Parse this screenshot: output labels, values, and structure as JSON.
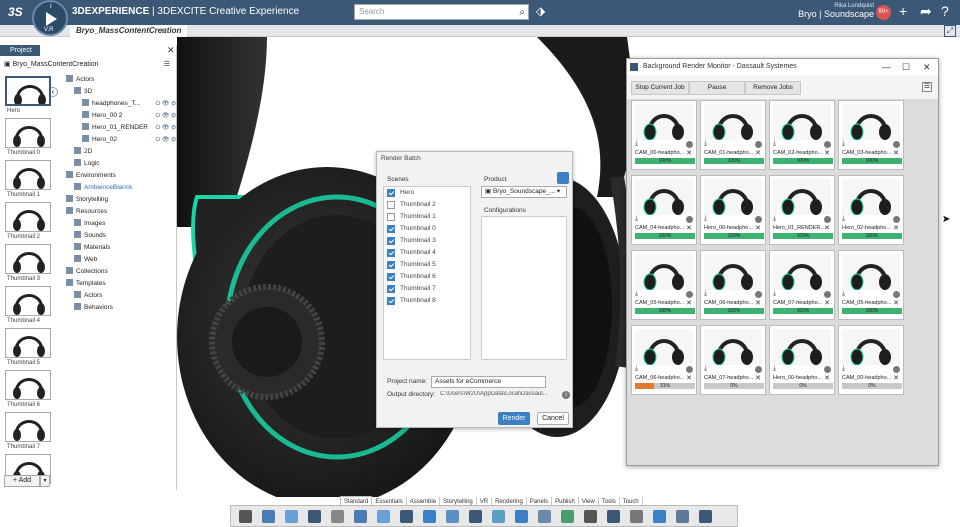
{
  "topbar": {
    "brand_prefix": "3DEXPERIENCE",
    "brand_app": "3DEXCITE Creative Experience",
    "search_placeholder": "Search",
    "user_name": "Rika Lundquist",
    "context": "Bryo | Soundscape",
    "notif_count": "99+",
    "compass_labels": [
      "V.R",
      "I"
    ]
  },
  "document": {
    "tab_label": "Bryo_MassContentCreation"
  },
  "project_panel": {
    "tab_label": "Project",
    "project_name": "Bryo_MassContentCreation",
    "thumbnails": [
      "Hero",
      "Thumbnail 0",
      "Thumbnail 1",
      "Thumbnail 2",
      "Thumbnail 3",
      "Thumbnail 4",
      "Thumbnail 5",
      "Thumbnail 6",
      "Thumbnail 7",
      ""
    ],
    "tree": [
      {
        "label": "Actors",
        "indent": 1
      },
      {
        "label": "3D",
        "indent": 2
      },
      {
        "label": "headphones_T...",
        "indent": 3
      },
      {
        "label": "Hero_00 2",
        "indent": 3
      },
      {
        "label": "Hero_01_RENDER",
        "indent": 3
      },
      {
        "label": "Hero_02",
        "indent": 3
      },
      {
        "label": "2D",
        "indent": 2
      },
      {
        "label": "Logic",
        "indent": 2
      },
      {
        "label": "Environments",
        "indent": 1
      },
      {
        "label": "AmbienceBlanck",
        "indent": 2
      },
      {
        "label": "Storytelling",
        "indent": 1
      },
      {
        "label": "Resources",
        "indent": 1
      },
      {
        "label": "Images",
        "indent": 2
      },
      {
        "label": "Sounds",
        "indent": 2
      },
      {
        "label": "Materials",
        "indent": 2
      },
      {
        "label": "Web",
        "indent": 2
      },
      {
        "label": "Collections",
        "indent": 1
      },
      {
        "label": "Templates",
        "indent": 1
      },
      {
        "label": "Actors",
        "indent": 2
      },
      {
        "label": "Behaviors",
        "indent": 2
      }
    ],
    "add_label": "Add"
  },
  "render_batch": {
    "title": "Render Batch",
    "scenes_label": "Scenes",
    "product_label": "Product",
    "configurations_label": "Configurations",
    "scenes": [
      {
        "label": "Hero",
        "checked": true
      },
      {
        "label": "Thumbnail 2",
        "checked": false
      },
      {
        "label": "Thumbnail 1",
        "checked": false
      },
      {
        "label": "Thumbnail 0",
        "checked": true
      },
      {
        "label": "Thumbnail 3",
        "checked": true
      },
      {
        "label": "Thumbnail 4",
        "checked": true
      },
      {
        "label": "Thumbnail 5",
        "checked": true
      },
      {
        "label": "Thumbnail 6",
        "checked": true
      },
      {
        "label": "Thumbnail 7",
        "checked": true
      },
      {
        "label": "Thumbnail 8",
        "checked": true
      }
    ],
    "product_value": "Bryo_Soundscape_...",
    "project_name_label": "Project name:",
    "project_name_value": "Assets for eCommerce",
    "output_dir_label": "Output directory:",
    "output_dir_value": "C:\\Users\\W2U\\AppData\\Local\\Dassaul...",
    "render_label": "Render",
    "cancel_label": "Cancel"
  },
  "monitor": {
    "title": "Background Render Monitor - Dassault Systemes",
    "stop_label": "Stop Current Job",
    "pause_label": "Pause",
    "remove_label": "Remove Jobs",
    "jobs": [
      {
        "name": "CAM_00-headpho...",
        "progress": 100,
        "label": "100%"
      },
      {
        "name": "CAM_01-headpho...",
        "progress": 100,
        "label": "100%"
      },
      {
        "name": "CAM_02-headpho...",
        "progress": 100,
        "label": "100%"
      },
      {
        "name": "CAM_03-headpho...",
        "progress": 100,
        "label": "100%"
      },
      {
        "name": "CAM_04-headpho...",
        "progress": 100,
        "label": "100%"
      },
      {
        "name": "Hero_00-headpho...",
        "progress": 100,
        "label": "100%"
      },
      {
        "name": "Hero_01_RENDER...",
        "progress": 100,
        "label": "100%"
      },
      {
        "name": "Hero_02-headpho...",
        "progress": 100,
        "label": "100%"
      },
      {
        "name": "CAM_05-headpho...",
        "progress": 100,
        "label": "100%"
      },
      {
        "name": "CAM_06-headpho...",
        "progress": 100,
        "label": "100%"
      },
      {
        "name": "CAM_07-headpho...",
        "progress": 100,
        "label": "100%"
      },
      {
        "name": "CAM_05-headpho...",
        "progress": 100,
        "label": "100%"
      },
      {
        "name": "CAM_06-headpho...",
        "progress": 31,
        "label": "31%"
      },
      {
        "name": "CAM_07-headpho...",
        "progress": 0,
        "label": "0%"
      },
      {
        "name": "Hero_00-headpho...",
        "progress": 0,
        "label": "0%"
      },
      {
        "name": "CAM_00-headpho...",
        "progress": 0,
        "label": "0%"
      }
    ]
  },
  "bottom_tabs": [
    "Standard",
    "Essentials",
    "Assemble",
    "Storytelling",
    "VR",
    "Rendering",
    "Panels",
    "Publish",
    "View",
    "Tools",
    "Touch"
  ],
  "colors": {
    "brand": "#3b5876",
    "accent": "#3b7fc4",
    "done": "#3cb371",
    "partial": "#e07b2a",
    "neon": "#19d6a6"
  }
}
